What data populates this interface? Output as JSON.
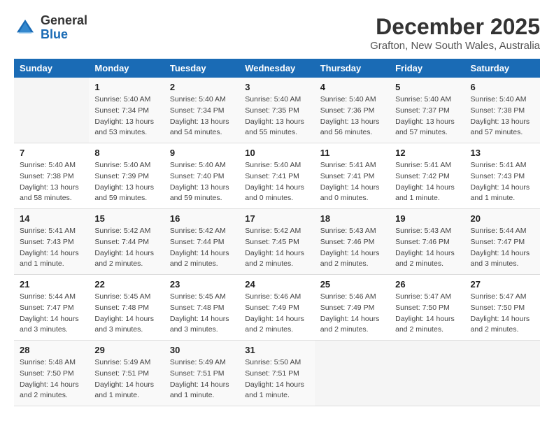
{
  "header": {
    "logo_general": "General",
    "logo_blue": "Blue",
    "month_year": "December 2025",
    "location": "Grafton, New South Wales, Australia"
  },
  "days_of_week": [
    "Sunday",
    "Monday",
    "Tuesday",
    "Wednesday",
    "Thursday",
    "Friday",
    "Saturday"
  ],
  "weeks": [
    [
      {
        "day": "",
        "sunrise": "",
        "sunset": "",
        "daylight": ""
      },
      {
        "day": "1",
        "sunrise": "Sunrise: 5:40 AM",
        "sunset": "Sunset: 7:34 PM",
        "daylight": "Daylight: 13 hours and 53 minutes."
      },
      {
        "day": "2",
        "sunrise": "Sunrise: 5:40 AM",
        "sunset": "Sunset: 7:34 PM",
        "daylight": "Daylight: 13 hours and 54 minutes."
      },
      {
        "day": "3",
        "sunrise": "Sunrise: 5:40 AM",
        "sunset": "Sunset: 7:35 PM",
        "daylight": "Daylight: 13 hours and 55 minutes."
      },
      {
        "day": "4",
        "sunrise": "Sunrise: 5:40 AM",
        "sunset": "Sunset: 7:36 PM",
        "daylight": "Daylight: 13 hours and 56 minutes."
      },
      {
        "day": "5",
        "sunrise": "Sunrise: 5:40 AM",
        "sunset": "Sunset: 7:37 PM",
        "daylight": "Daylight: 13 hours and 57 minutes."
      },
      {
        "day": "6",
        "sunrise": "Sunrise: 5:40 AM",
        "sunset": "Sunset: 7:38 PM",
        "daylight": "Daylight: 13 hours and 57 minutes."
      }
    ],
    [
      {
        "day": "7",
        "sunrise": "Sunrise: 5:40 AM",
        "sunset": "Sunset: 7:38 PM",
        "daylight": "Daylight: 13 hours and 58 minutes."
      },
      {
        "day": "8",
        "sunrise": "Sunrise: 5:40 AM",
        "sunset": "Sunset: 7:39 PM",
        "daylight": "Daylight: 13 hours and 59 minutes."
      },
      {
        "day": "9",
        "sunrise": "Sunrise: 5:40 AM",
        "sunset": "Sunset: 7:40 PM",
        "daylight": "Daylight: 13 hours and 59 minutes."
      },
      {
        "day": "10",
        "sunrise": "Sunrise: 5:40 AM",
        "sunset": "Sunset: 7:41 PM",
        "daylight": "Daylight: 14 hours and 0 minutes."
      },
      {
        "day": "11",
        "sunrise": "Sunrise: 5:41 AM",
        "sunset": "Sunset: 7:41 PM",
        "daylight": "Daylight: 14 hours and 0 minutes."
      },
      {
        "day": "12",
        "sunrise": "Sunrise: 5:41 AM",
        "sunset": "Sunset: 7:42 PM",
        "daylight": "Daylight: 14 hours and 1 minute."
      },
      {
        "day": "13",
        "sunrise": "Sunrise: 5:41 AM",
        "sunset": "Sunset: 7:43 PM",
        "daylight": "Daylight: 14 hours and 1 minute."
      }
    ],
    [
      {
        "day": "14",
        "sunrise": "Sunrise: 5:41 AM",
        "sunset": "Sunset: 7:43 PM",
        "daylight": "Daylight: 14 hours and 1 minute."
      },
      {
        "day": "15",
        "sunrise": "Sunrise: 5:42 AM",
        "sunset": "Sunset: 7:44 PM",
        "daylight": "Daylight: 14 hours and 2 minutes."
      },
      {
        "day": "16",
        "sunrise": "Sunrise: 5:42 AM",
        "sunset": "Sunset: 7:44 PM",
        "daylight": "Daylight: 14 hours and 2 minutes."
      },
      {
        "day": "17",
        "sunrise": "Sunrise: 5:42 AM",
        "sunset": "Sunset: 7:45 PM",
        "daylight": "Daylight: 14 hours and 2 minutes."
      },
      {
        "day": "18",
        "sunrise": "Sunrise: 5:43 AM",
        "sunset": "Sunset: 7:46 PM",
        "daylight": "Daylight: 14 hours and 2 minutes."
      },
      {
        "day": "19",
        "sunrise": "Sunrise: 5:43 AM",
        "sunset": "Sunset: 7:46 PM",
        "daylight": "Daylight: 14 hours and 2 minutes."
      },
      {
        "day": "20",
        "sunrise": "Sunrise: 5:44 AM",
        "sunset": "Sunset: 7:47 PM",
        "daylight": "Daylight: 14 hours and 3 minutes."
      }
    ],
    [
      {
        "day": "21",
        "sunrise": "Sunrise: 5:44 AM",
        "sunset": "Sunset: 7:47 PM",
        "daylight": "Daylight: 14 hours and 3 minutes."
      },
      {
        "day": "22",
        "sunrise": "Sunrise: 5:45 AM",
        "sunset": "Sunset: 7:48 PM",
        "daylight": "Daylight: 14 hours and 3 minutes."
      },
      {
        "day": "23",
        "sunrise": "Sunrise: 5:45 AM",
        "sunset": "Sunset: 7:48 PM",
        "daylight": "Daylight: 14 hours and 3 minutes."
      },
      {
        "day": "24",
        "sunrise": "Sunrise: 5:46 AM",
        "sunset": "Sunset: 7:49 PM",
        "daylight": "Daylight: 14 hours and 2 minutes."
      },
      {
        "day": "25",
        "sunrise": "Sunrise: 5:46 AM",
        "sunset": "Sunset: 7:49 PM",
        "daylight": "Daylight: 14 hours and 2 minutes."
      },
      {
        "day": "26",
        "sunrise": "Sunrise: 5:47 AM",
        "sunset": "Sunset: 7:50 PM",
        "daylight": "Daylight: 14 hours and 2 minutes."
      },
      {
        "day": "27",
        "sunrise": "Sunrise: 5:47 AM",
        "sunset": "Sunset: 7:50 PM",
        "daylight": "Daylight: 14 hours and 2 minutes."
      }
    ],
    [
      {
        "day": "28",
        "sunrise": "Sunrise: 5:48 AM",
        "sunset": "Sunset: 7:50 PM",
        "daylight": "Daylight: 14 hours and 2 minutes."
      },
      {
        "day": "29",
        "sunrise": "Sunrise: 5:49 AM",
        "sunset": "Sunset: 7:51 PM",
        "daylight": "Daylight: 14 hours and 1 minute."
      },
      {
        "day": "30",
        "sunrise": "Sunrise: 5:49 AM",
        "sunset": "Sunset: 7:51 PM",
        "daylight": "Daylight: 14 hours and 1 minute."
      },
      {
        "day": "31",
        "sunrise": "Sunrise: 5:50 AM",
        "sunset": "Sunset: 7:51 PM",
        "daylight": "Daylight: 14 hours and 1 minute."
      },
      {
        "day": "",
        "sunrise": "",
        "sunset": "",
        "daylight": ""
      },
      {
        "day": "",
        "sunrise": "",
        "sunset": "",
        "daylight": ""
      },
      {
        "day": "",
        "sunrise": "",
        "sunset": "",
        "daylight": ""
      }
    ]
  ]
}
